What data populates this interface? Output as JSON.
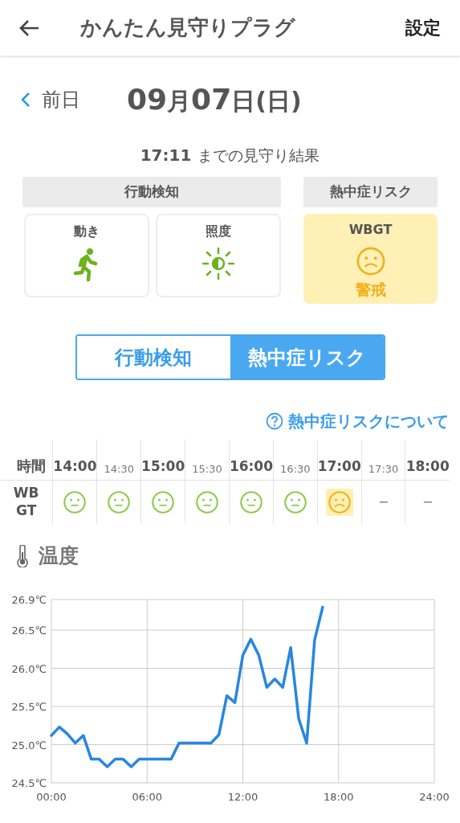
{
  "header": {
    "title": "かんたん見守りプラグ",
    "settings": "設定"
  },
  "date_nav": {
    "prev": "前日",
    "date_parts": [
      {
        "text": "09",
        "kind": "number"
      },
      {
        "text": "月",
        "kind": "unit"
      },
      {
        "text": "07",
        "kind": "number"
      },
      {
        "text": "日",
        "kind": "unit"
      },
      {
        "text": "(日)",
        "kind": "unit"
      }
    ]
  },
  "summary": {
    "time": "17:11",
    "text": "までの見守り結果"
  },
  "groups": [
    {
      "title": "行動検知",
      "cards": [
        {
          "label": "動き",
          "kind": "motion"
        },
        {
          "label": "照度",
          "kind": "light"
        }
      ]
    },
    {
      "title": "熱中症リスク",
      "cards": [
        {
          "label": "WBGT",
          "kind": "wbgt",
          "status": "警戒",
          "warning": true
        }
      ]
    }
  ],
  "toggle": [
    {
      "label": "行動検知",
      "selected": false
    },
    {
      "label": "熱中症リスク",
      "selected": true
    }
  ],
  "help_link": "熱中症リスクについて",
  "table": {
    "row_labels": [
      "時間",
      "WB\nGT"
    ],
    "columns": [
      {
        "time": "14:00",
        "major": true,
        "kind": "normal"
      },
      {
        "time": "14:30",
        "major": false,
        "kind": "normal"
      },
      {
        "time": "15:00",
        "major": true,
        "kind": "normal"
      },
      {
        "time": "15:30",
        "major": false,
        "kind": "normal"
      },
      {
        "time": "16:00",
        "major": true,
        "kind": "normal"
      },
      {
        "time": "16:30",
        "major": false,
        "kind": "normal"
      },
      {
        "time": "17:00",
        "major": true,
        "kind": "warning"
      },
      {
        "time": "17:30",
        "major": false,
        "kind": "none",
        "text": "−"
      },
      {
        "time": "18:00",
        "major": true,
        "kind": "none",
        "text": "−"
      }
    ]
  },
  "temperature": {
    "title": "温度",
    "chart_data": {
      "type": "line",
      "grid": true,
      "x": [
        0,
        0.5,
        1,
        1.5,
        2,
        2.5,
        3,
        3.5,
        4,
        4.5,
        5,
        5.5,
        6,
        6.5,
        7,
        7.5,
        8,
        8.5,
        9,
        9.5,
        10,
        10.5,
        11,
        11.5,
        12,
        12.5,
        13,
        13.5,
        14,
        14.5,
        15,
        15.5,
        16,
        16.5,
        17
      ],
      "series": [
        {
          "color": "#2a86de",
          "values": [
            25.12,
            25.23,
            25.14,
            25.02,
            25.12,
            24.81,
            24.81,
            24.71,
            24.81,
            24.81,
            24.71,
            24.81,
            24.81,
            24.81,
            24.81,
            24.81,
            25.02,
            25.02,
            25.02,
            25.02,
            25.02,
            25.13,
            25.64,
            25.55,
            26.17,
            26.38,
            26.17,
            25.75,
            25.86,
            25.75,
            26.27,
            25.34,
            25.02,
            26.37,
            26.8
          ]
        }
      ],
      "xlim": [
        0,
        24
      ],
      "ylim": [
        24.5,
        26.9
      ],
      "xticks": [
        {
          "value": 0,
          "label": "00:00"
        },
        {
          "value": 6,
          "label": "06:00"
        },
        {
          "value": 12,
          "label": "12:00"
        },
        {
          "value": 18,
          "label": "18:00"
        },
        {
          "value": 24,
          "label": "24:00"
        }
      ],
      "yticks": [
        {
          "value": 24.5,
          "label": "24.5℃"
        },
        {
          "value": 25,
          "label": "25.0℃"
        },
        {
          "value": 25.5,
          "label": "25.5℃"
        },
        {
          "value": 26,
          "label": "26.0℃"
        },
        {
          "value": 26.5,
          "label": "26.5℃"
        },
        {
          "value": 26.9,
          "label": "26.9℃"
        }
      ]
    }
  }
}
